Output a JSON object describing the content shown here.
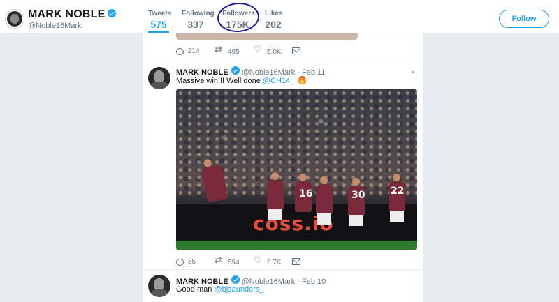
{
  "profile": {
    "name": "MARK NOBLE",
    "handle": "@Noble16Mark"
  },
  "stats": [
    {
      "label": "Tweets",
      "value": "575"
    },
    {
      "label": "Following",
      "value": "337"
    },
    {
      "label": "Followers",
      "value": "175K"
    },
    {
      "label": "Likes",
      "value": "202"
    }
  ],
  "follow_button": "Follow",
  "tweets": [
    {
      "actions": {
        "replies": "214",
        "retweets": "495",
        "likes": "5.0K"
      }
    },
    {
      "name": "MARK NOBLE",
      "handle_date": "@Noble16Mark · Feb 11",
      "text": "Massive win!!! Well done",
      "mention": "@CH14_",
      "photo": {
        "board_text": "coss.io",
        "shirt_numbers": [
          "16",
          "30",
          "22"
        ]
      },
      "actions": {
        "replies": "85",
        "retweets": "594",
        "likes": "6.7K"
      }
    },
    {
      "name": "MARK NOBLE",
      "handle_date": "@Noble16Mark · Feb 10",
      "text": "Good man",
      "mention": "@bjsaunders_"
    }
  ],
  "colors": {
    "accent": "#1da1f2",
    "annotation_circle": "#1a1aa8",
    "background": "#e6ecf0"
  }
}
